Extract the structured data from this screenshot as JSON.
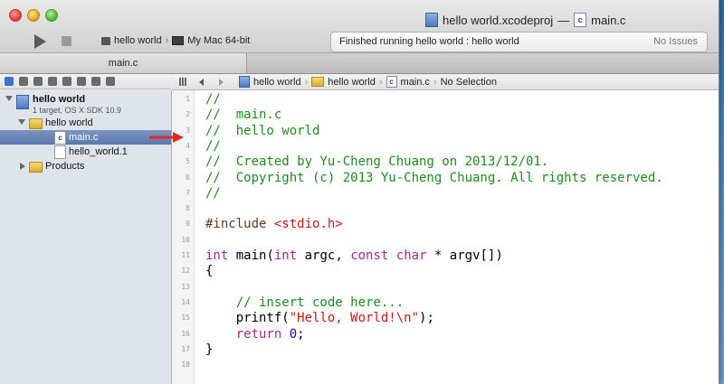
{
  "window": {
    "title_project": "hello world.xcodeproj",
    "title_sep": "—",
    "title_file": "main.c"
  },
  "toolbar": {
    "scheme": "hello world",
    "destination": "My Mac 64-bit",
    "activity_message": "Finished running hello world : hello world",
    "issues": "No Issues"
  },
  "tab": {
    "label": "main.c"
  },
  "sidebar": {
    "project_name": "hello world",
    "project_sub": "1 target, OS X SDK 10.9",
    "group_name": "hello world",
    "file_main": "main.c",
    "file_man": "hello_world.1",
    "products": "Products"
  },
  "jumpbar": {
    "crumb1": "hello world",
    "crumb2": "hello world",
    "crumb3": "main.c",
    "crumb4": "No Selection"
  },
  "code_lines": [
    {
      "n": "1",
      "text": "//"
    },
    {
      "n": "2",
      "text": "//  main.c"
    },
    {
      "n": "3",
      "text": "//  hello world"
    },
    {
      "n": "4",
      "text": "//"
    },
    {
      "n": "5",
      "text": "//  Created by Yu-Cheng Chuang on 2013/12/01."
    },
    {
      "n": "6",
      "text": "//  Copyright (c) 2013 Yu-Cheng Chuang. All rights reserved."
    },
    {
      "n": "7",
      "text": "//"
    },
    {
      "n": "8",
      "text": ""
    },
    {
      "n": "9",
      "text": "#include <stdio.h>"
    },
    {
      "n": "10",
      "text": ""
    },
    {
      "n": "11",
      "text": "int main(int argc, const char * argv[])"
    },
    {
      "n": "12",
      "text": "{"
    },
    {
      "n": "13",
      "text": ""
    },
    {
      "n": "14",
      "text": "    // insert code here..."
    },
    {
      "n": "15",
      "text": "    printf(\"Hello, World!\\n\");"
    },
    {
      "n": "16",
      "text": "    return 0;"
    },
    {
      "n": "17",
      "text": "}"
    },
    {
      "n": "18",
      "text": ""
    }
  ],
  "colors": {
    "comment": "#1e8a1e",
    "keyword": "#a12a8a",
    "string": "#c41a16",
    "number": "#1c00cf",
    "arrow": "#e0282a",
    "selection": "#5a78ad"
  }
}
